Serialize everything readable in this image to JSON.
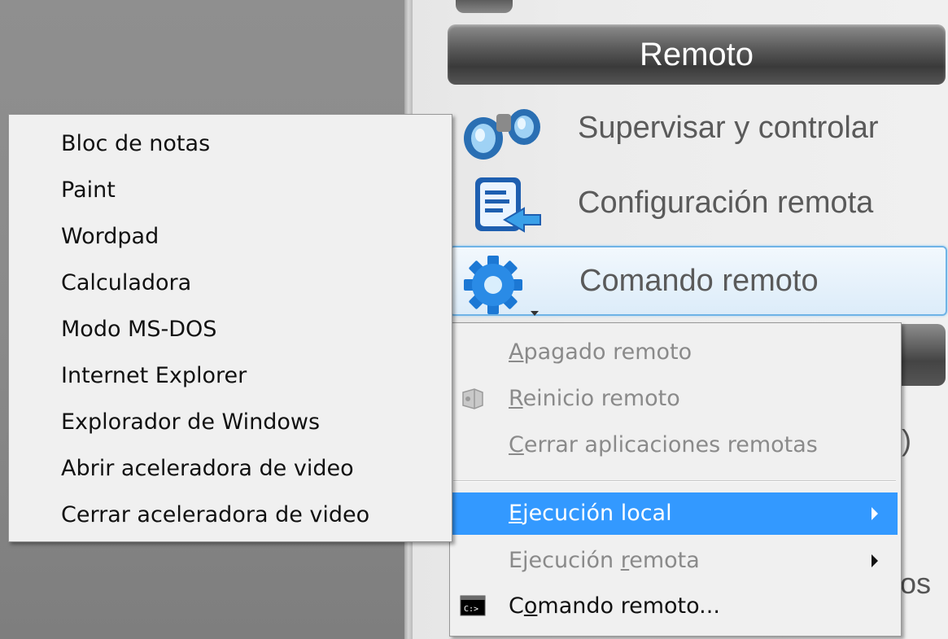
{
  "section": {
    "title": "Remoto"
  },
  "actions": [
    {
      "label": "Supervisar y controlar",
      "icon": "binoculars-icon"
    },
    {
      "label": "Configuración remota",
      "icon": "remote-config-icon"
    },
    {
      "label": "Comando remoto",
      "icon": "gear-icon"
    }
  ],
  "peek_text": "os",
  "context_menu": {
    "items": [
      {
        "pre": "",
        "key": "A",
        "post": "pagado remoto",
        "enabled": false
      },
      {
        "pre": "",
        "key": "R",
        "post": "einicio remoto",
        "enabled": false,
        "icon": "restart-icon"
      },
      {
        "pre": "",
        "key": "C",
        "post": "errar aplicaciones remotas",
        "enabled": false
      },
      {
        "pre": "",
        "key": "E",
        "post": "jecución local",
        "enabled": true,
        "highlighted": true,
        "submenu": true
      },
      {
        "pre": "Ejecución ",
        "key": "r",
        "post": "emota",
        "enabled": false,
        "submenu": true
      },
      {
        "pre": "C",
        "key": "o",
        "post": "mando remoto...",
        "enabled": true,
        "icon": "cmd-prompt-icon"
      }
    ]
  },
  "submenu": {
    "items": [
      "Bloc de notas",
      "Paint",
      "Wordpad",
      "Calculadora",
      "Modo MS-DOS",
      "Internet Explorer",
      "Explorador de Windows",
      "Abrir aceleradora de video",
      "Cerrar aceleradora de video"
    ]
  },
  "colors": {
    "highlight": "#3399ff",
    "menu_bg": "#f0f0f0",
    "disabled_text": "#8a8a8a"
  }
}
